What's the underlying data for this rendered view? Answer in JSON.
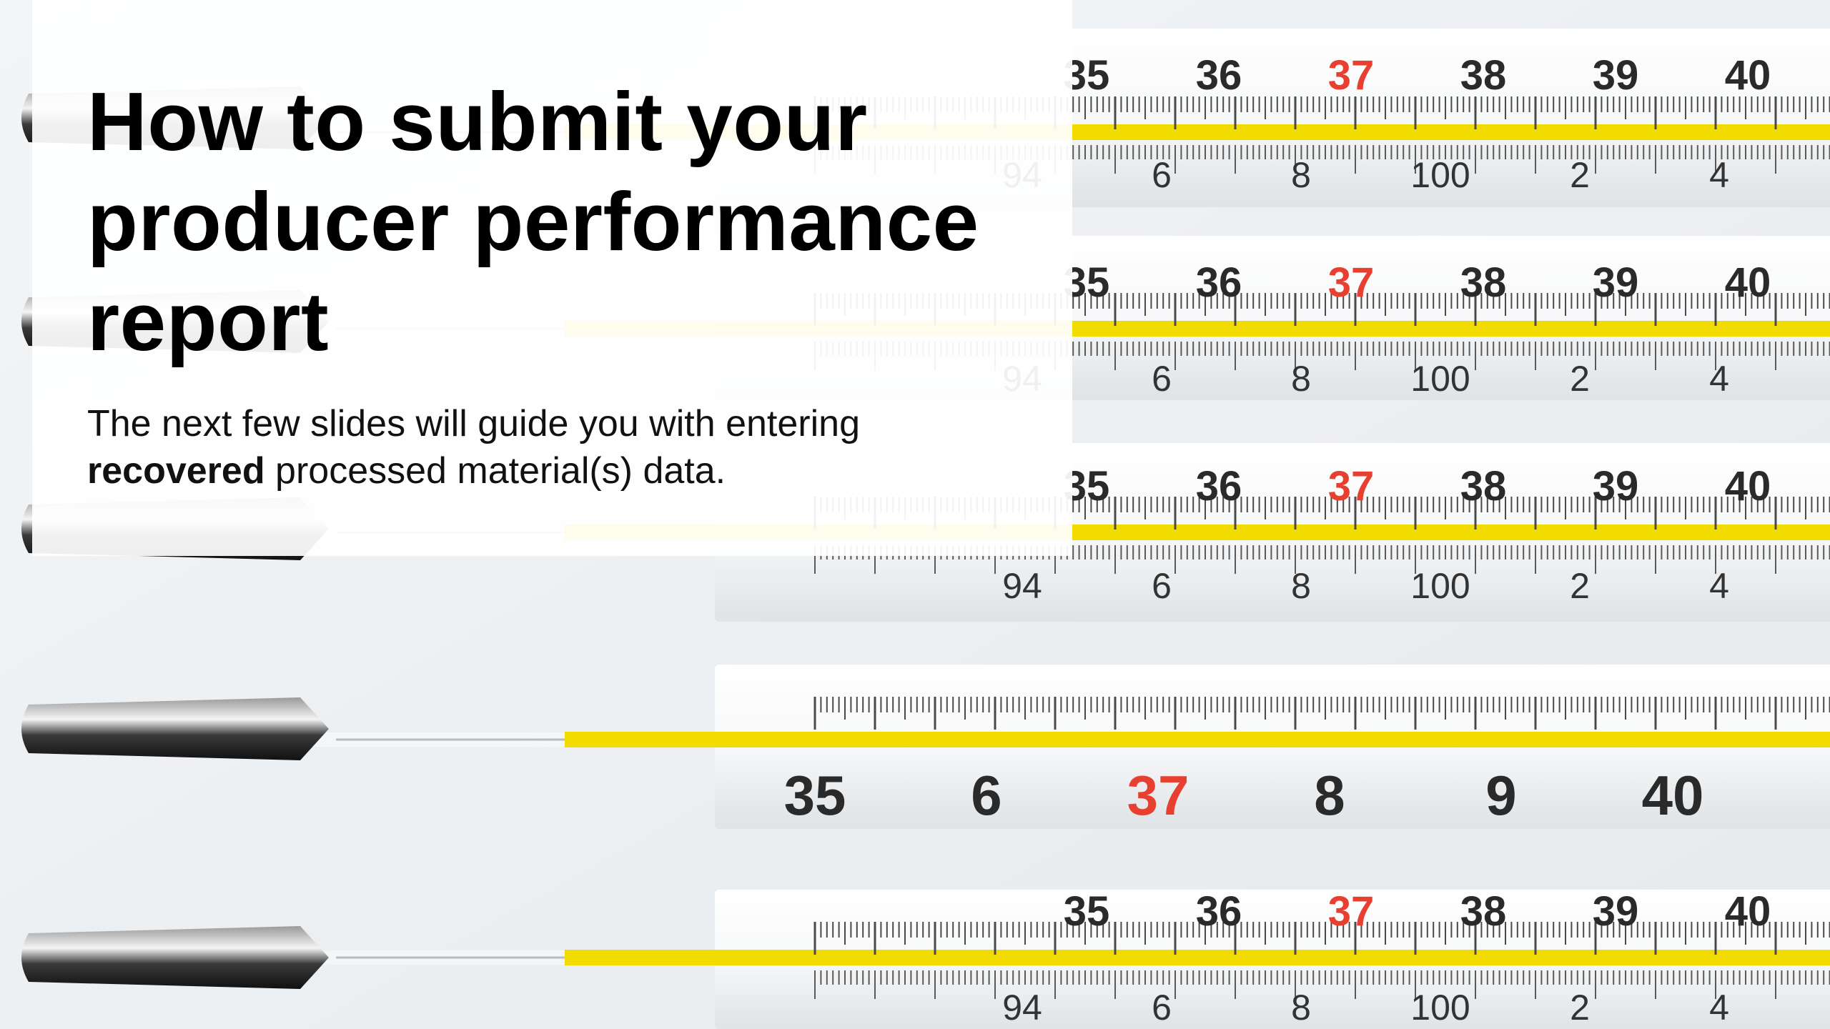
{
  "slide": {
    "title": "How to submit your producer performance report",
    "subtitle_line1": "The next few slides will guide you with entering",
    "subtitle_bold": "recovered",
    "subtitle_rest": " processed material(s) data."
  },
  "background_image": {
    "subject": "thermometers",
    "colors": {
      "mercury": "#f2dc00",
      "red_numeral": "#e84030",
      "numeral": "#2a2a2a",
      "glass": "#ffffff"
    },
    "thermometers": [
      {
        "labels": [
          "35",
          "36",
          "37",
          "38",
          "39",
          "40"
        ],
        "sub_labels": [
          "94",
          "6",
          "8",
          "100",
          "2",
          "4"
        ],
        "highlight_index": 2
      },
      {
        "labels": [
          "35",
          "36",
          "37",
          "38",
          "39",
          "40"
        ],
        "sub_labels": [
          "94",
          "6",
          "8",
          "100",
          "2",
          "4"
        ],
        "highlight_index": 2
      },
      {
        "labels": [
          "35",
          "36",
          "37",
          "38",
          "39",
          "40"
        ],
        "sub_labels": [
          "94",
          "6",
          "8",
          "100",
          "2",
          "4"
        ],
        "highlight_index": 2
      },
      {
        "labels": [
          "35",
          "6",
          "37",
          "8",
          "9",
          "40"
        ],
        "sub_labels": [],
        "highlight_index": 2
      },
      {
        "labels": [
          "35",
          "36",
          "37",
          "38",
          "39",
          "40"
        ],
        "sub_labels": [
          "94",
          "6",
          "8",
          "100",
          "2",
          "4"
        ],
        "highlight_index": 2
      }
    ]
  }
}
